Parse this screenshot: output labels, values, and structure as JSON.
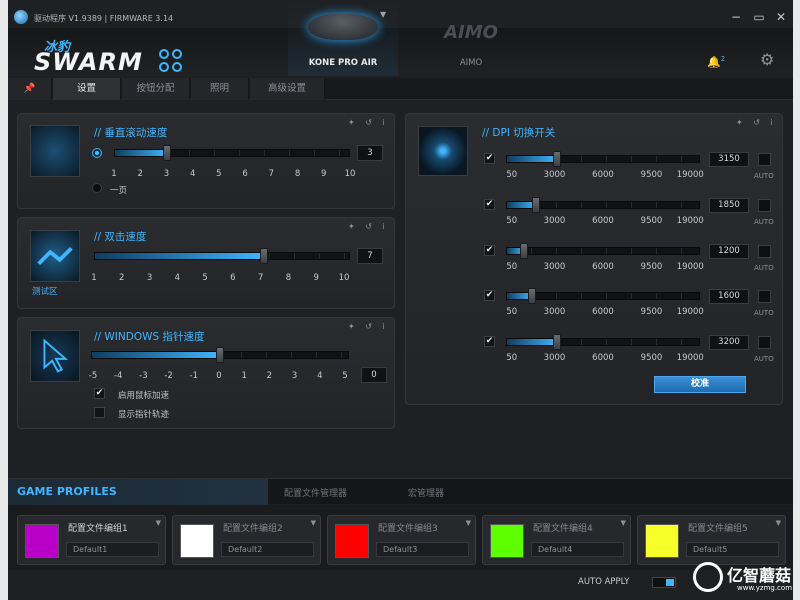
{
  "window": {
    "title": "驱动程序 V1.9389 | FIRMWARE 3.14",
    "buttons": [
      "−",
      "▭",
      "✕"
    ]
  },
  "brand": {
    "cn": "冰豹",
    "name": "SWARM"
  },
  "devices": [
    {
      "label": "KONE PRO AIR",
      "active": true
    },
    {
      "logo": "AIMO",
      "label": "AIMO",
      "active": false
    }
  ],
  "notifications": {
    "count": "2"
  },
  "tabs": [
    "设置",
    "按钮分配",
    "照明",
    "高级设置"
  ],
  "vertical_scroll": {
    "title": "// 垂直滚动速度",
    "ticks": [
      "1",
      "2",
      "3",
      "4",
      "5",
      "6",
      "7",
      "8",
      "9",
      "10"
    ],
    "value": "3",
    "value_fraction": 0.222,
    "option_label": "一页"
  },
  "double_click": {
    "title": "// 双击速度",
    "ticks": [
      "1",
      "2",
      "3",
      "4",
      "5",
      "6",
      "7",
      "8",
      "9",
      "10"
    ],
    "value": "7",
    "value_fraction": 0.667,
    "test_area_label": "测试区"
  },
  "pointer_speed": {
    "title": "// WINDOWS 指针速度",
    "ticks": [
      "-5",
      "-4",
      "-3",
      "-2",
      "-1",
      "0",
      "1",
      "2",
      "3",
      "4",
      "5"
    ],
    "value": "0",
    "value_fraction": 0.5,
    "options": [
      {
        "label": "启用鼠标加速",
        "checked": true
      },
      {
        "label": "显示指针轨迹",
        "checked": false
      }
    ]
  },
  "dpi": {
    "title": "// DPI 切换开关",
    "ticks": [
      "50",
      "3000",
      "6000",
      "9500",
      "19000"
    ],
    "auto_label": "AUTO",
    "calibrate_label": "校准",
    "levels": [
      {
        "value": "3150",
        "fraction": 0.26,
        "checked": true
      },
      {
        "value": "1850",
        "fraction": 0.15,
        "checked": true
      },
      {
        "value": "1200",
        "fraction": 0.09,
        "checked": true
      },
      {
        "value": "1600",
        "fraction": 0.13,
        "checked": true
      },
      {
        "value": "3200",
        "fraction": 0.26,
        "checked": true
      }
    ]
  },
  "bottom": {
    "game_profiles": "GAME PROFILES",
    "tabs": [
      "配置文件管理器",
      "宏管理器"
    ],
    "profiles": [
      {
        "name": "配置文件编组1",
        "default": "Default1",
        "color": "#b800c8",
        "active": true
      },
      {
        "name": "配置文件编组2",
        "default": "Default2",
        "color": "#ffffff",
        "active": false
      },
      {
        "name": "配置文件编组3",
        "default": "Default3",
        "color": "#ff0000",
        "active": false
      },
      {
        "name": "配置文件编组4",
        "default": "Default4",
        "color": "#5dff00",
        "active": false
      },
      {
        "name": "配置文件编组5",
        "default": "Default5",
        "color": "#f6ff2a",
        "active": false
      }
    ],
    "auto_apply": "AUTO APPLY"
  },
  "watermark": {
    "text": "亿智蘑菇",
    "url": "www.yzmg.com"
  },
  "colors": {
    "accent": "#3fb6ff",
    "background": "#1f2022",
    "panel": "#2a2c2f"
  }
}
